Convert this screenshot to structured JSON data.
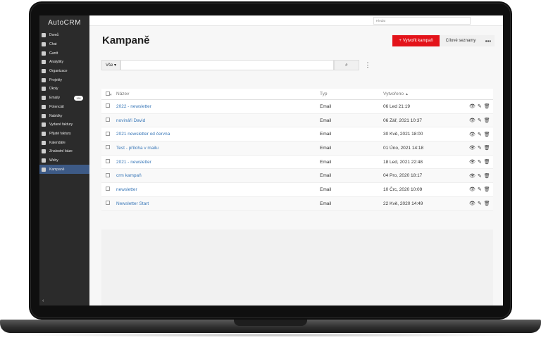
{
  "app": {
    "brand": "AutoCRM"
  },
  "sidebar": {
    "items": [
      {
        "label": "Domů",
        "icon": "grid-icon"
      },
      {
        "label": "Chat",
        "icon": "monitor-icon"
      },
      {
        "label": "Gantt",
        "icon": "gantt-icon"
      },
      {
        "label": "Analytiky",
        "icon": "analytics-icon"
      },
      {
        "label": "Organizace",
        "icon": "building-icon"
      },
      {
        "label": "Projekty",
        "icon": "projects-icon"
      },
      {
        "label": "Úkoly",
        "icon": "tasks-icon"
      },
      {
        "label": "Emaily",
        "icon": "email-icon",
        "badge": "191"
      },
      {
        "label": "Potenciál",
        "icon": "id-card-icon"
      },
      {
        "label": "Nabídky",
        "icon": "document-icon"
      },
      {
        "label": "Vydané faktury",
        "icon": "invoice-out-icon"
      },
      {
        "label": "Přijaté faktury",
        "icon": "invoice-in-icon"
      },
      {
        "label": "Kalendáře",
        "icon": "calendar-icon"
      },
      {
        "label": "Znalostní báze",
        "icon": "book-icon"
      },
      {
        "label": "Weby",
        "icon": "globe-icon"
      },
      {
        "label": "Kampaně",
        "icon": "chart-icon",
        "active": true
      }
    ],
    "collapse": "‹"
  },
  "topbar": {
    "search_placeholder": "Hledat"
  },
  "page": {
    "title": "Kampaně"
  },
  "actions": {
    "create": "Vytvořit kampaň",
    "lists": "Cílové seznamy",
    "more": "•••"
  },
  "filter": {
    "select": "Vše ▾",
    "search_icon": "⌕",
    "kebab": "⋮"
  },
  "table": {
    "headers": {
      "name": "Název",
      "type": "Typ",
      "created": "Vytvořeno"
    },
    "rows": [
      {
        "name": "2022 - newsletter",
        "type": "Email",
        "created": "06 Led 21:19"
      },
      {
        "name": "novináři David",
        "type": "Email",
        "created": "06 Zář, 2021 10:37"
      },
      {
        "name": "2021 newsletter od června",
        "type": "Email",
        "created": "30 Kvě, 2021 18:00"
      },
      {
        "name": "Test - příloha v mailu",
        "type": "Email",
        "created": "01 Úno, 2021 14:18"
      },
      {
        "name": "2021 - newsletter",
        "type": "Email",
        "created": "18 Led, 2021 22:48"
      },
      {
        "name": "crm kampaň",
        "type": "Email",
        "created": "04 Pro, 2020 18:17"
      },
      {
        "name": "newsletter",
        "type": "Email",
        "created": "10 Črc, 2020 10:09"
      },
      {
        "name": "Newsletter Start",
        "type": "Email",
        "created": "22 Kvě, 2020 14:49"
      }
    ]
  },
  "colors": {
    "accent": "#e3131a",
    "link": "#3a78b8",
    "sidebar": "#2b2b2b",
    "active": "#3d5a86"
  }
}
